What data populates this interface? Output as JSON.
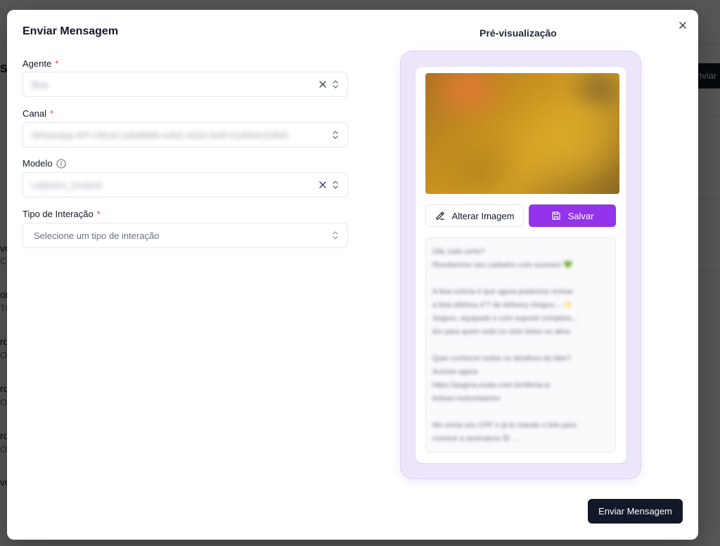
{
  "background": {
    "fragments": [
      "S",
      "vo",
      "C",
      "or",
      "Tu",
      "ro",
      "O",
      "ro",
      "O",
      "ro",
      "O",
      "ro",
      "O",
      "vo"
    ],
    "button_label": "nviar"
  },
  "modal": {
    "title": "Enviar Mensagem",
    "close_icon": "close-icon"
  },
  "form": {
    "agent": {
      "label": "Agente",
      "required": "*",
      "value": "Bea"
    },
    "channel": {
      "label": "Canal",
      "required": "*",
      "value": "WhatsApp API Oficial (e8d9b6b-e4b2-4d1b-9c6f-01d064c53f0f)"
    },
    "template": {
      "label": "Modelo",
      "value": "cadastro_inviável"
    },
    "interaction_type": {
      "label": "Tipo de Interação",
      "required": "*",
      "placeholder": "Selecione um tipo de interação"
    }
  },
  "preview": {
    "title": "Pré-visualização",
    "change_image_label": "Alterar Imagem",
    "save_label": "Salvar",
    "message_lines": [
      "Olá, tudo certo?",
      "Recebemos seu cadastro com sucesso 💚",
      "",
      "A boa notícia é que agora podemos revisar",
      "a lista elétrica 4*7 de delivery chegou ...✨",
      "Seguro, equipado e com suporte completo...",
      "tiro para quem está no ciclo letivo ou ativo",
      "",
      "Quer conhecer todos os detalhes da bike?",
      "Acesse agora",
      "https://pagina.exato.com.br/oferta-a-",
      "bolsas-motoristas/en",
      "",
      "Me envia seu CPF e já te mando o link para",
      "concluir a assinatura 😊 ..."
    ]
  },
  "footer": {
    "send_label": "Enviar Mensagem"
  },
  "colors": {
    "accent": "#9333ea",
    "primary_dark": "#111827",
    "preview_bg": "#ede6fb",
    "required": "#ef4444"
  }
}
